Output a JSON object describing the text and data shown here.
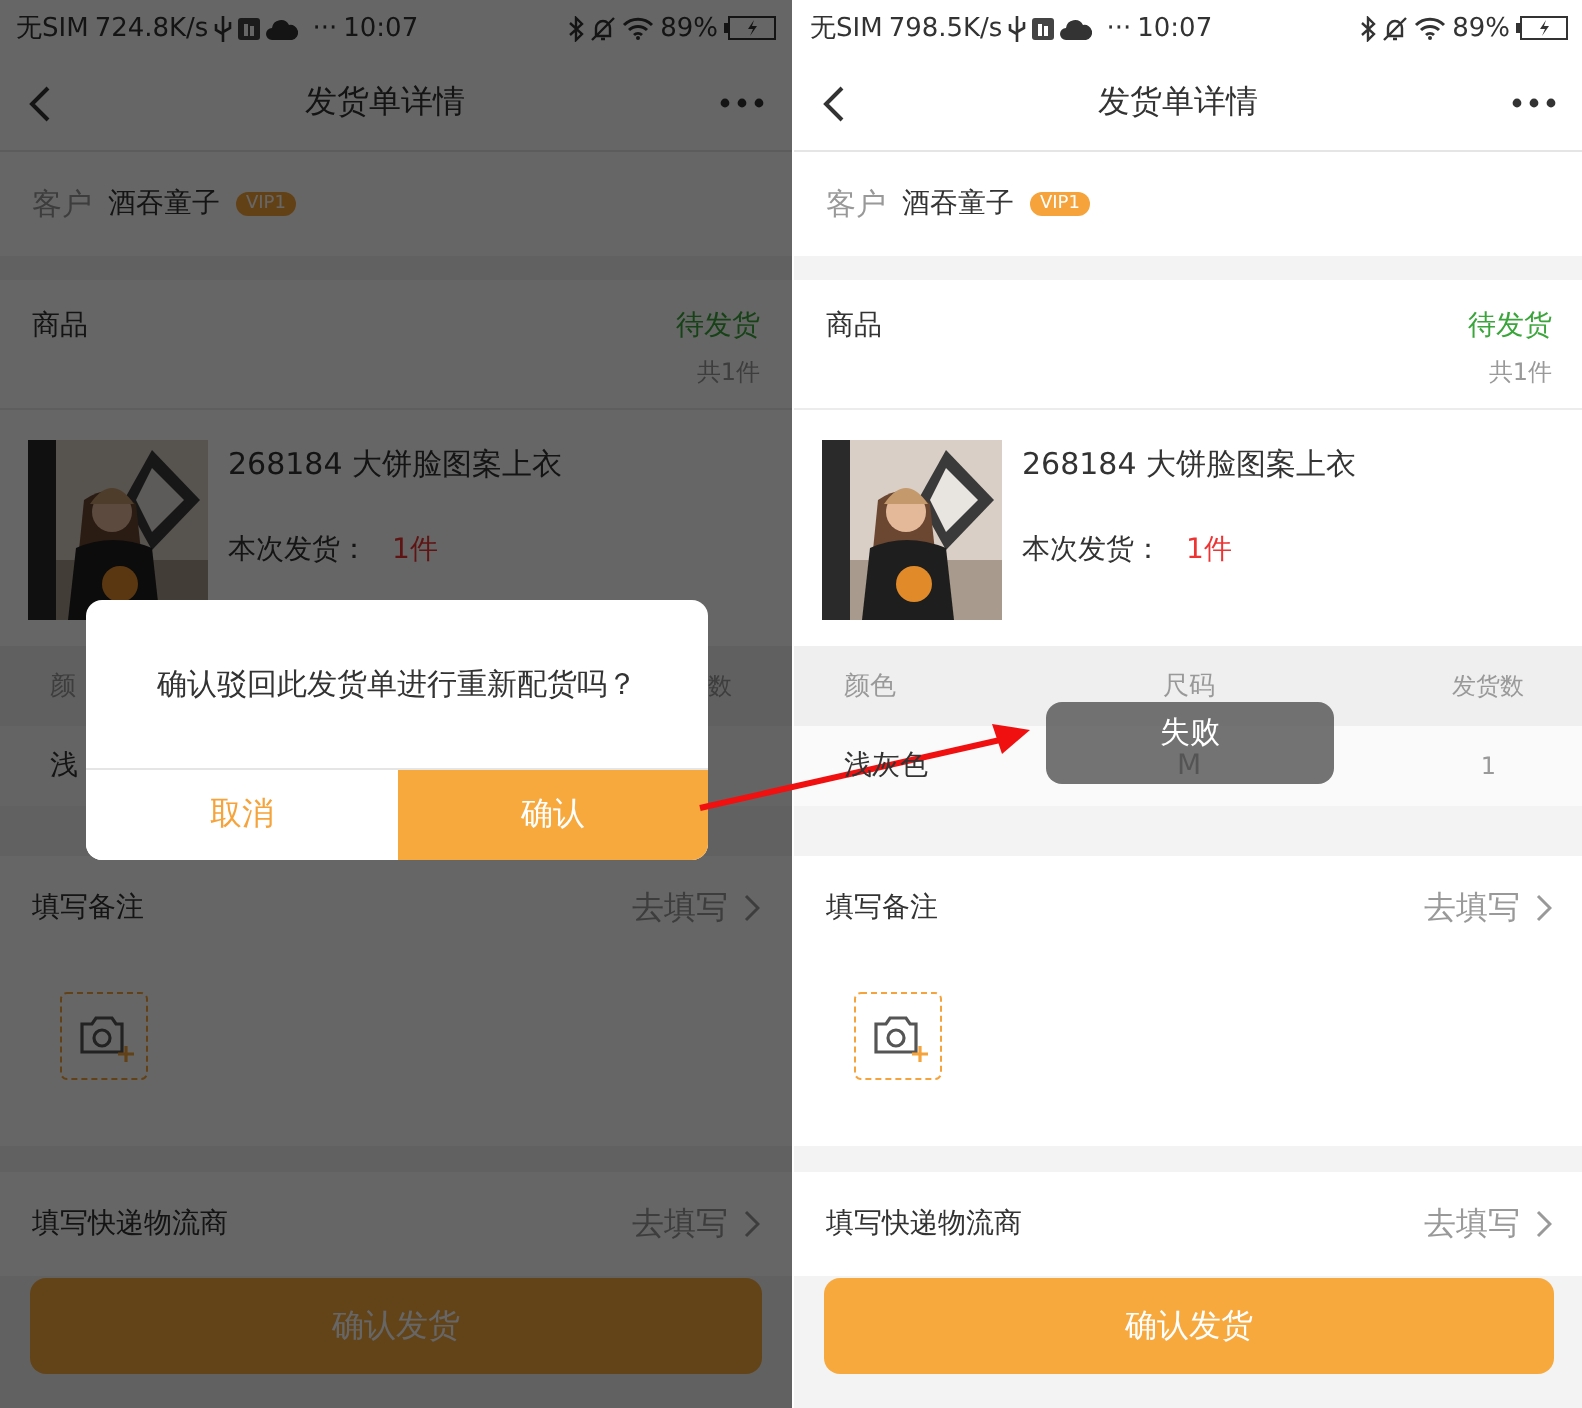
{
  "screens": [
    {
      "status_bar": {
        "carrier": "无SIM",
        "speed": "724.8K/s",
        "more": "···",
        "time": "10:07",
        "battery": "89%"
      },
      "nav": {
        "title": "发货单详情"
      },
      "customer": {
        "label": "客户",
        "name": "酒吞童子",
        "badge": "VIP1"
      },
      "goods": {
        "label": "商品",
        "status": "待发货",
        "count": "共1件"
      },
      "product": {
        "kind": "picture",
        "name": "268184 大饼脸图案上衣",
        "qty_label": "本次发货：",
        "qty": "1件"
      },
      "table": {
        "columns": [
          {
            "kind": "color",
            "text": "颜"
          },
          {
            "kind": "count",
            "text": "数"
          }
        ],
        "rows": [
          {
            "cells": [
              {
                "kind": "color",
                "text": "浅"
              }
            ]
          }
        ]
      },
      "remark": {
        "label": "填写备注",
        "action": "去填写"
      },
      "logistics": {
        "label": "填写快递物流商",
        "action": "去填写"
      },
      "submit": "确认发货",
      "dialog": {
        "message": "确认驳回此发货单进行重新配货吗？",
        "cancel": "取消",
        "confirm": "确认"
      }
    },
    {
      "status_bar": {
        "carrier": "无SIM",
        "speed": "798.5K/s",
        "more": "···",
        "time": "10:07",
        "battery": "89%"
      },
      "nav": {
        "title": "发货单详情"
      },
      "customer": {
        "label": "客户",
        "name": "酒吞童子",
        "badge": "VIP1"
      },
      "goods": {
        "label": "商品",
        "status": "待发货",
        "count": "共1件"
      },
      "product": {
        "kind": "picture",
        "name": "268184 大饼脸图案上衣",
        "qty_label": "本次发货：",
        "qty": "1件"
      },
      "table": {
        "columns": [
          {
            "kind": "color",
            "text": "颜色"
          },
          {
            "kind": "size",
            "text": "尺码"
          },
          {
            "kind": "count",
            "text": "发货数"
          }
        ],
        "rows": [
          {
            "cells": [
              {
                "kind": "color",
                "text": "浅灰色"
              },
              {
                "kind": "size",
                "text": "M"
              },
              {
                "kind": "count",
                "text": "1"
              }
            ]
          }
        ]
      },
      "remark": {
        "label": "填写备注",
        "action": "去填写"
      },
      "logistics": {
        "label": "填写快递物流商",
        "action": "去填写"
      },
      "submit": "确认发货",
      "toast": "失败"
    }
  ]
}
